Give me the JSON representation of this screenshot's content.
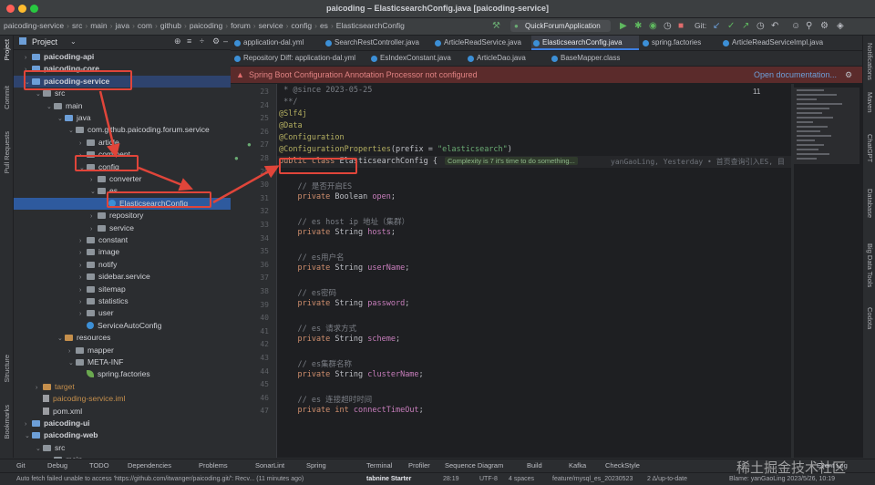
{
  "window": {
    "title": "paicoding – ElasticsearchConfig.java [paicoding-service]"
  },
  "breadcrumbs": [
    "paicoding-service",
    "src",
    "main",
    "java",
    "com",
    "github",
    "paicoding",
    "forum",
    "service",
    "config",
    "es",
    "ElasticsearchConfig"
  ],
  "run_config": "QuickForumApplication",
  "git_label": "Git:",
  "left_strip": [
    "Project",
    "Commit",
    "Pull Requests",
    "Structure",
    "Bookmarks"
  ],
  "project_panel": {
    "title": "Project"
  },
  "tree": [
    {
      "label": "paicoding-api",
      "bold": true
    },
    {
      "label": "paicoding-core",
      "bold": true
    },
    {
      "label": "paicoding-service",
      "bold": true
    },
    {
      "label": "src"
    },
    {
      "label": "main"
    },
    {
      "label": "java"
    },
    {
      "label": "com.github.paicoding.forum.service"
    },
    {
      "label": "article"
    },
    {
      "label": "comment"
    },
    {
      "label": "config"
    },
    {
      "label": "converter"
    },
    {
      "label": "es"
    },
    {
      "label": "ElasticsearchConfig"
    },
    {
      "label": "repository"
    },
    {
      "label": "service"
    },
    {
      "label": "constant"
    },
    {
      "label": "image"
    },
    {
      "label": "notify"
    },
    {
      "label": "sidebar.service"
    },
    {
      "label": "sitemap"
    },
    {
      "label": "statistics"
    },
    {
      "label": "user"
    },
    {
      "label": "ServiceAutoConfig"
    },
    {
      "label": "resources"
    },
    {
      "label": "mapper"
    },
    {
      "label": "META-INF"
    },
    {
      "label": "spring.factories"
    },
    {
      "label": "target"
    },
    {
      "label": "paicoding-service.iml"
    },
    {
      "label": "pom.xml"
    },
    {
      "label": "paicoding-ui",
      "bold": true
    },
    {
      "label": "paicoding-web",
      "bold": true
    },
    {
      "label": "src"
    },
    {
      "label": "main"
    }
  ],
  "tabs_row1": [
    "application-dal.yml",
    "SearchRestController.java",
    "ArticleReadService.java",
    "ElasticsearchConfig.java",
    "spring.factories",
    "ArticleReadServiceImpl.java"
  ],
  "tabs_row2": [
    "Repository Diff: application-dal.yml",
    "EsIndexConstant.java",
    "ArticleDao.java",
    "BaseMapper.class"
  ],
  "banner": {
    "text": "Spring Boot Configuration Annotation Processor not configured",
    "link": "Open documentation..."
  },
  "editor": {
    "line_numbers": [
      "23",
      "24",
      "25",
      "26",
      "27",
      "28",
      "29",
      "30",
      "31",
      "32",
      "33",
      "34",
      "35",
      "36",
      "37",
      "38",
      "39",
      "40",
      "41",
      "42",
      "43",
      "44",
      "45",
      "46",
      "47"
    ],
    "inspection_count": "11",
    "code_lines": [
      [
        {
          "t": " * ",
          "c": "cm"
        },
        {
          "t": "@since",
          "c": "cm"
        },
        {
          "t": " 2023-05-25",
          "c": "cm"
        }
      ],
      [
        {
          "t": " **/",
          "c": "cm"
        }
      ],
      [
        {
          "t": "@Slf4j",
          "c": "ann"
        }
      ],
      [
        {
          "t": "@Data",
          "c": "ann"
        }
      ],
      [
        {
          "t": "@Configuration",
          "c": "ann"
        }
      ],
      [
        {
          "t": "@ConfigurationProperties",
          "c": "ann"
        },
        {
          "t": "(prefix = ",
          "c": "typ"
        },
        {
          "t": "\"elasticsearch\"",
          "c": "str"
        },
        {
          "t": ")",
          "c": "typ"
        }
      ],
      [
        {
          "t": "public class ",
          "c": "kw"
        },
        {
          "t": "ElasticsearchConfig {",
          "c": "typ"
        }
      ],
      [],
      [
        {
          "t": "    // 是否开启ES",
          "c": "cm"
        }
      ],
      [
        {
          "t": "    private ",
          "c": "kw"
        },
        {
          "t": "Boolean ",
          "c": "typ"
        },
        {
          "t": "open",
          "c": "fld"
        },
        {
          "t": ";",
          "c": "typ"
        }
      ],
      [],
      [
        {
          "t": "    // es host ip 地址（集群）",
          "c": "cm"
        }
      ],
      [
        {
          "t": "    private ",
          "c": "kw"
        },
        {
          "t": "String ",
          "c": "typ"
        },
        {
          "t": "hosts",
          "c": "fld"
        },
        {
          "t": ";",
          "c": "typ"
        }
      ],
      [],
      [
        {
          "t": "    // es用户名",
          "c": "cm"
        }
      ],
      [
        {
          "t": "    private ",
          "c": "kw"
        },
        {
          "t": "String ",
          "c": "typ"
        },
        {
          "t": "userName",
          "c": "fld"
        },
        {
          "t": ";",
          "c": "typ"
        }
      ],
      [],
      [
        {
          "t": "    // es密码",
          "c": "cm"
        }
      ],
      [
        {
          "t": "    private ",
          "c": "kw"
        },
        {
          "t": "String ",
          "c": "typ"
        },
        {
          "t": "password",
          "c": "fld"
        },
        {
          "t": ";",
          "c": "typ"
        }
      ],
      [],
      [
        {
          "t": "    // es 请求方式",
          "c": "cm"
        }
      ],
      [
        {
          "t": "    private ",
          "c": "kw"
        },
        {
          "t": "String ",
          "c": "typ"
        },
        {
          "t": "scheme",
          "c": "fld"
        },
        {
          "t": ";",
          "c": "typ"
        }
      ],
      [],
      [
        {
          "t": "    // es集群名称",
          "c": "cm"
        }
      ],
      [
        {
          "t": "    private ",
          "c": "kw"
        },
        {
          "t": "String ",
          "c": "typ"
        },
        {
          "t": "clusterName",
          "c": "fld"
        },
        {
          "t": ";",
          "c": "typ"
        }
      ],
      [],
      [
        {
          "t": "    // es 连接超时时间",
          "c": "cm"
        }
      ],
      [
        {
          "t": "    private ",
          "c": "kw"
        },
        {
          "t": "int ",
          "c": "kw"
        },
        {
          "t": "connectTimeOut",
          "c": "fld"
        },
        {
          "t": ";",
          "c": "typ"
        }
      ]
    ],
    "inlay_hint": "Complexity is 7 it's time to do something...",
    "blame_hint": "yanGaoLing, Yesterday • 首页查询引入ES, 目"
  },
  "right_strip": [
    "Notifications",
    "Maven",
    "ChatGPT",
    "Database",
    "Big Data Tools",
    "Codota"
  ],
  "tool_windows": [
    "Git",
    "Debug",
    "TODO",
    "Dependencies",
    "Problems",
    "SonarLint",
    "Spring",
    "Terminal",
    "Profiler",
    "Sequence Diagram",
    "Build",
    "Kafka",
    "CheckStyle",
    "Event Log"
  ],
  "status": {
    "message": "Auto fetch failed unable to access 'https://github.com/itwanger/paicoding.git/': Recv... (11 minutes ago)",
    "tabnine": "tabnine Starter",
    "position": "28:19",
    "encoding": "UTF-8",
    "indent": "4 spaces",
    "branch": "feature/mysql_es_20230523",
    "sync": "2 Δ/up-to-date",
    "blame": "Blame: yanGaoLing 2023/5/26, 10:19",
    "watermark": "稀土掘金技术社区"
  },
  "colors": {
    "accent": "#3d7ee0",
    "annotation_red": "#e0453a",
    "banner_bg": "#5b2b2b"
  }
}
